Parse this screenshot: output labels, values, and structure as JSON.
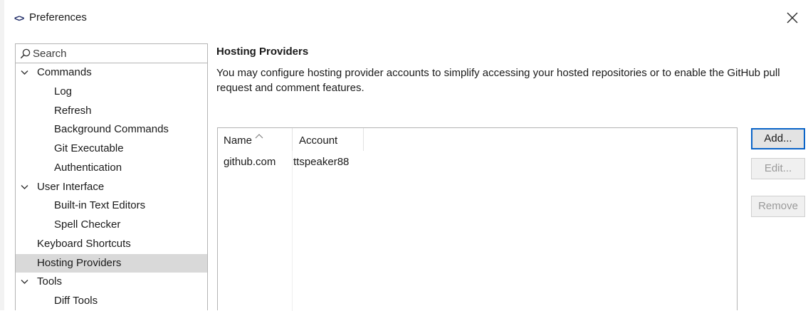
{
  "window": {
    "title": "Preferences",
    "app_icon": "<>"
  },
  "search": {
    "placeholder": "Search",
    "value": ""
  },
  "nav": {
    "items": [
      {
        "label": "Commands",
        "kind": "parent",
        "expanded": true
      },
      {
        "label": "Log",
        "kind": "child"
      },
      {
        "label": "Refresh",
        "kind": "child"
      },
      {
        "label": "Background Commands",
        "kind": "child"
      },
      {
        "label": "Git Executable",
        "kind": "child"
      },
      {
        "label": "Authentication",
        "kind": "child"
      },
      {
        "label": "User Interface",
        "kind": "parent",
        "expanded": true
      },
      {
        "label": "Built-in Text Editors",
        "kind": "child"
      },
      {
        "label": "Spell Checker",
        "kind": "child"
      },
      {
        "label": "Keyboard Shortcuts",
        "kind": "leaf"
      },
      {
        "label": "Hosting Providers",
        "kind": "leaf",
        "selected": true
      },
      {
        "label": "Tools",
        "kind": "parent",
        "expanded": true
      },
      {
        "label": "Diff Tools",
        "kind": "child"
      }
    ]
  },
  "page": {
    "title": "Hosting Providers",
    "description": "You may configure hosting provider accounts to simplify accessing your hosted repositories or to enable the GitHub pull request and comment features."
  },
  "table": {
    "columns": [
      "Name",
      "Account"
    ],
    "rows": [
      {
        "name": "github.com",
        "account": "ttspeaker88"
      }
    ]
  },
  "buttons": {
    "add": "Add...",
    "edit": "Edit...",
    "remove": "Remove"
  },
  "colors": {
    "accent": "#0a64c8",
    "selection": "#d9d9d9",
    "border": "#b4b4b4",
    "disabled_text": "#9a9a9a"
  },
  "icons": {
    "app": "app-logo-icon",
    "close": "close-icon",
    "search": "search-icon",
    "expand": "chevron-down-icon",
    "sort": "sort-ascending-icon"
  }
}
